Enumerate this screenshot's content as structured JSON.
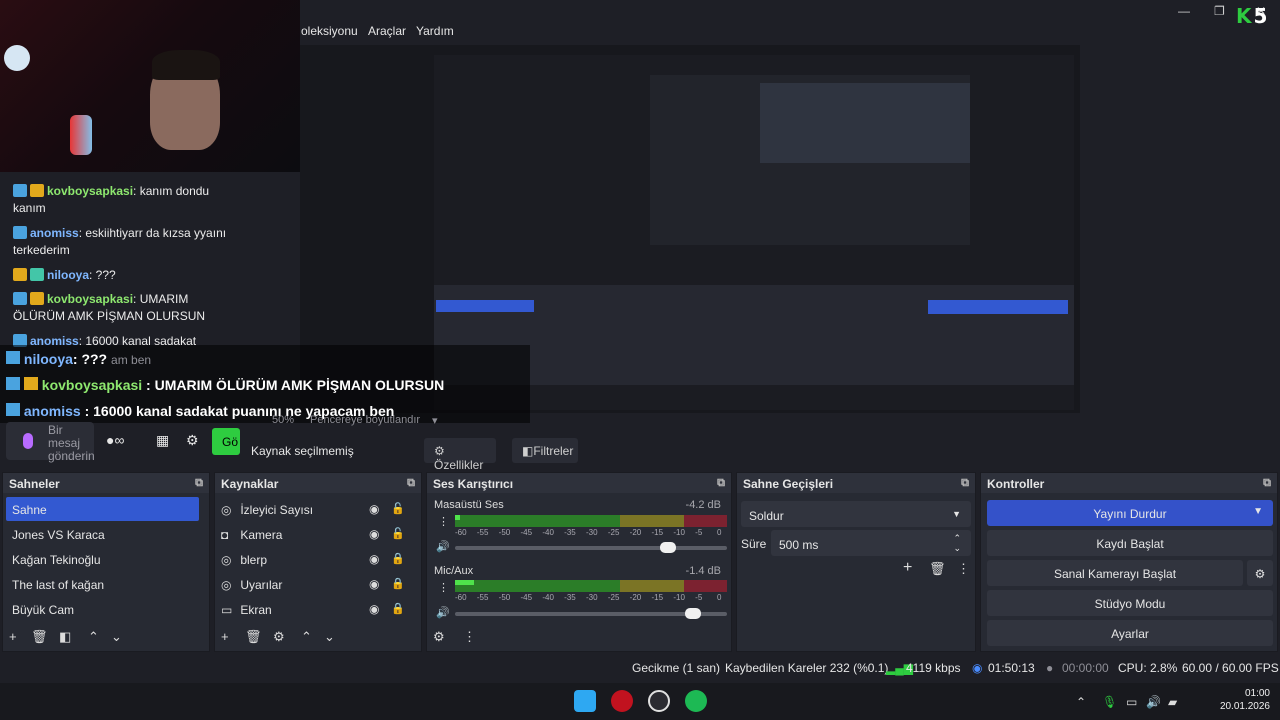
{
  "menu": [
    "oleksiyonu",
    "Araçlar",
    "Yardım"
  ],
  "logo": {
    "k": "K",
    "five": "5"
  },
  "chat": {
    "lines": [
      {
        "user": "kovboysapkasi",
        "text": ": kanım dondu kanım"
      },
      {
        "user": "anomiss",
        "text": ": eskiihtiyarr da kızsa yyaını terkederim"
      },
      {
        "user": "nilooya",
        "text": ": ???"
      },
      {
        "user": "kovboysapkasi",
        "text": ": UMARIM ÖLÜRÜM AMK PİŞMAN OLURSUN"
      },
      {
        "user": "anomiss",
        "text": ": 16000 kanal sadakat"
      }
    ],
    "big": [
      {
        "user": "nilooya",
        "text": ": ???",
        "tail": "am ben"
      },
      {
        "user": "kovboysapkasi",
        "text": " : UMARIM ÖLÜRÜM AMK PİŞMAN OLURSUN"
      },
      {
        "user": "anomiss",
        "text": " : 16000 kanal sadakat puanını ne yapacam ben"
      }
    ],
    "input_placeholder": "Bir mesaj gönderin",
    "send_label": "Gö"
  },
  "toolbar": {
    "zoom": "50%",
    "zoom_fit": "Pencereye boyutlandır",
    "source_status": "Kaynak seçilmemiş",
    "properties": "Özellikler",
    "filters": "Filtreler"
  },
  "scenes": {
    "title": "Sahneler",
    "items": [
      "Sahne",
      "Jones VS Karaca",
      "Kağan Tekinoğlu",
      "The last of kağan",
      "Büyük Cam"
    ]
  },
  "sources": {
    "title": "Kaynaklar",
    "items": [
      {
        "label": "İzleyici Sayısı",
        "icon": "globe-icon"
      },
      {
        "label": "Kamera",
        "icon": "camera-icon"
      },
      {
        "label": "blerp",
        "icon": "globe-icon"
      },
      {
        "label": "Uyarılar",
        "icon": "globe-icon"
      },
      {
        "label": "Ekran",
        "icon": "monitor-icon"
      }
    ]
  },
  "mixer": {
    "title": "Ses Karıştırıcı",
    "scale": [
      "-60",
      "-55",
      "-50",
      "-45",
      "-40",
      "-35",
      "-30",
      "-25",
      "-20",
      "-15",
      "-10",
      "-5",
      "0"
    ],
    "channels": [
      {
        "name": "Masaüstü Ses",
        "db": "-4.2 dB",
        "level": 0.02,
        "volume": 0.8
      },
      {
        "name": "Mic/Aux",
        "db": "-1.4 dB",
        "level": 0.07,
        "volume": 0.9
      }
    ]
  },
  "transitions": {
    "title": "Sahne Geçişleri",
    "selected": "Soldur",
    "duration_label": "Süre",
    "duration_value": "500 ms"
  },
  "controls": {
    "title": "Kontroller",
    "stream": "Yayını Durdur",
    "record": "Kaydı Başlat",
    "vcam": "Sanal Kamerayı Başlat",
    "studio": "Stüdyo Modu",
    "settings": "Ayarlar"
  },
  "status": {
    "delay": "Gecikme (1 san)",
    "dropped": "Kaybedilen Kareler 232 (%0.1)",
    "bitrate": "4119 kbps",
    "stream_time": "01:50:13",
    "rec_time": "00:00:00",
    "cpu": "CPU: 2.8%",
    "fps": "60.00 / 60.00 FPS"
  },
  "clock": {
    "time": "01:00",
    "date": "20.01.2026"
  },
  "colors": {
    "accent": "#3359d1",
    "live": "#2ecc40"
  }
}
